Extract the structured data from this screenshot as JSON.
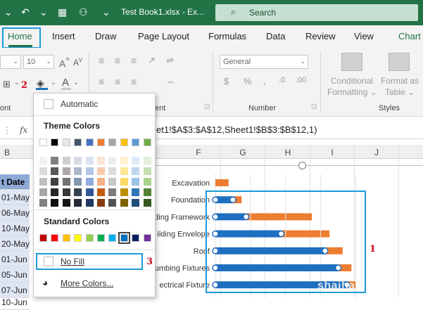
{
  "window": {
    "title": "Test Book1.xlsx",
    "title_suffix": "- Ex...",
    "search_label": "Search"
  },
  "ribbon_tabs": [
    "Home",
    "Insert",
    "Draw",
    "Page Layout",
    "Formulas",
    "Data",
    "Review",
    "View",
    "Chart"
  ],
  "ribbon": {
    "font_size_value": "10",
    "number_format_value": "General",
    "conditional_formatting_line1": "Conditional",
    "conditional_formatting_line2": "Formatting",
    "format_as_table_line1": "Format as",
    "format_as_table_line2": "Table",
    "group_font": "ont",
    "group_alignment": "ent",
    "group_number": "Number",
    "group_styles": "Styles"
  },
  "formula_bar": {
    "fx_label": "fx",
    "formula": "et1!$A$3:$A$12,Sheet1!$B$3:$B$12,1)"
  },
  "columns": [
    "B",
    "F",
    "G",
    "H",
    "I",
    "J"
  ],
  "rows": {
    "header": "t Date",
    "dates": [
      "01-May",
      "06-May",
      "10-May",
      "20-May",
      "01-Jun",
      "05-Jun",
      "07-Jun",
      "10-Jun"
    ]
  },
  "chart_data": {
    "type": "bar",
    "orientation": "horizontal",
    "categories": [
      "Excavation",
      "Foundation",
      "ding Framework",
      "ilding Envelope",
      "Roof",
      "lumbing Fixtures",
      "ectrical Fixture"
    ],
    "series": [
      {
        "color": "#1f6fc0",
        "values": [
          0,
          4,
          7,
          15,
          25,
          28,
          30
        ]
      },
      {
        "color": "#ed7d31",
        "values": [
          3,
          2,
          15,
          11,
          4,
          3,
          2
        ]
      }
    ],
    "xlim": [
      0,
      34
    ]
  },
  "dropdown": {
    "automatic": "Automatic",
    "theme_colors_label": "Theme Colors",
    "standard_colors_label": "Standard Colors",
    "no_fill": "No Fill",
    "more_colors": "More Colors...",
    "theme_top": [
      "#ffffff",
      "#000000",
      "#e7e6e6",
      "#44546a",
      "#4472c4",
      "#ed7d31",
      "#a5a5a5",
      "#ffc000",
      "#5b9bd5",
      "#70ad47"
    ],
    "theme_shades": [
      [
        "#f2f2f2",
        "#d9d9d9",
        "#bfbfbf",
        "#a6a6a6",
        "#808080"
      ],
      [
        "#7f7f7f",
        "#595959",
        "#404040",
        "#262626",
        "#0d0d0d"
      ],
      [
        "#d0cece",
        "#aeaaaa",
        "#757171",
        "#3a3838",
        "#171616"
      ],
      [
        "#d6dce4",
        "#adb9ca",
        "#8496b0",
        "#333f4f",
        "#222a35"
      ],
      [
        "#dae3f3",
        "#b4c7e7",
        "#8faadc",
        "#2f5597",
        "#203864"
      ],
      [
        "#fbe5d6",
        "#f8cbad",
        "#f4b183",
        "#c55a11",
        "#843c0c"
      ],
      [
        "#ededed",
        "#dbdbdb",
        "#c9c9c9",
        "#7b7b7b",
        "#525252"
      ],
      [
        "#fff2cc",
        "#ffe699",
        "#ffd966",
        "#bf9000",
        "#7f6000"
      ],
      [
        "#deebf7",
        "#bdd7ee",
        "#9dc3e6",
        "#2e75b6",
        "#1f4e79"
      ],
      [
        "#e2f0d9",
        "#c5e0b4",
        "#a9d18e",
        "#548235",
        "#385723"
      ]
    ],
    "standard": [
      "#c00000",
      "#ff0000",
      "#ffc000",
      "#ffff00",
      "#92d050",
      "#00b050",
      "#00b0f0",
      "#0070c0",
      "#002060",
      "#7030a0"
    ]
  },
  "annotations": {
    "n1": "1",
    "n2": "2",
    "n3": "3"
  },
  "watermark": "shaiha"
}
